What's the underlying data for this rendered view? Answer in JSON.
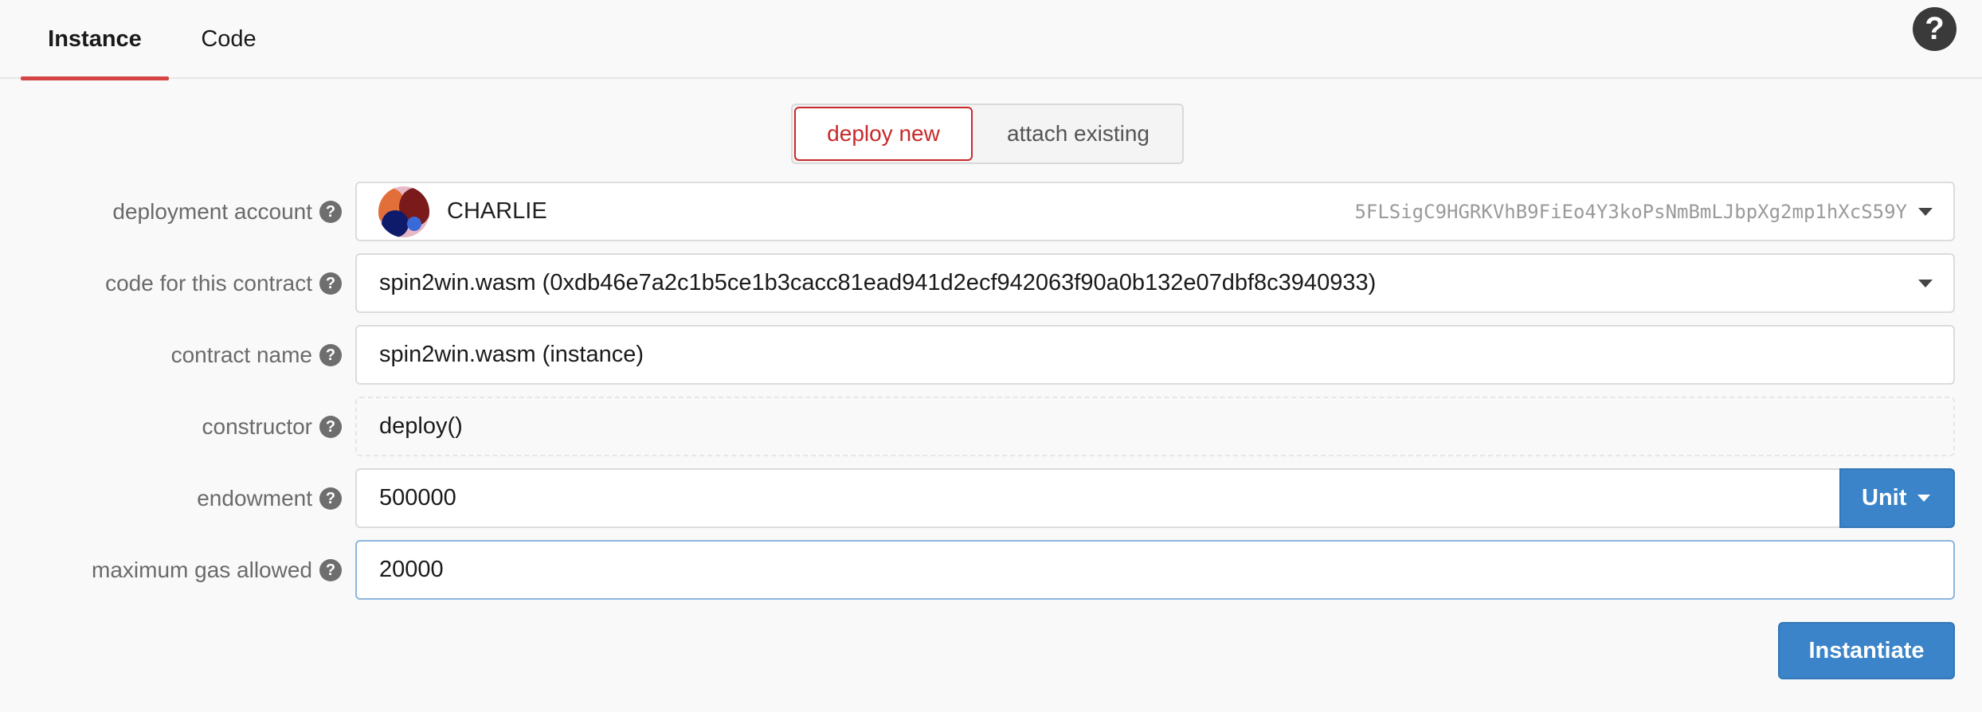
{
  "tabs": [
    {
      "label": "Instance",
      "active": true
    },
    {
      "label": "Code",
      "active": false
    }
  ],
  "help_icon": "question-circle-icon",
  "mode_toggle": {
    "deploy_label": "deploy new",
    "attach_label": "attach existing",
    "selected": "deploy new"
  },
  "form": {
    "deployment_account": {
      "label": "deployment account",
      "name": "CHARLIE",
      "address": "5FLSigC9HGRKVhB9FiEo4Y3koPsNmBmLJbpXg2mp1hXcS59Y"
    },
    "code": {
      "label": "code for this contract",
      "value": "spin2win.wasm (0xdb46e7a2c1b5ce1b3cacc81ead941d2ecf942063f90a0b132e07dbf8c3940933)"
    },
    "contract_name": {
      "label": "contract name",
      "value": "spin2win.wasm (instance)"
    },
    "constructor": {
      "label": "constructor",
      "value": "deploy()"
    },
    "endowment": {
      "label": "endowment",
      "value": "500000",
      "unit": "Unit"
    },
    "max_gas": {
      "label": "maximum gas allowed",
      "value": "20000"
    }
  },
  "submit_label": "Instantiate",
  "colors": {
    "accent_red": "#c72a2a",
    "primary_blue": "#3b84c9"
  }
}
